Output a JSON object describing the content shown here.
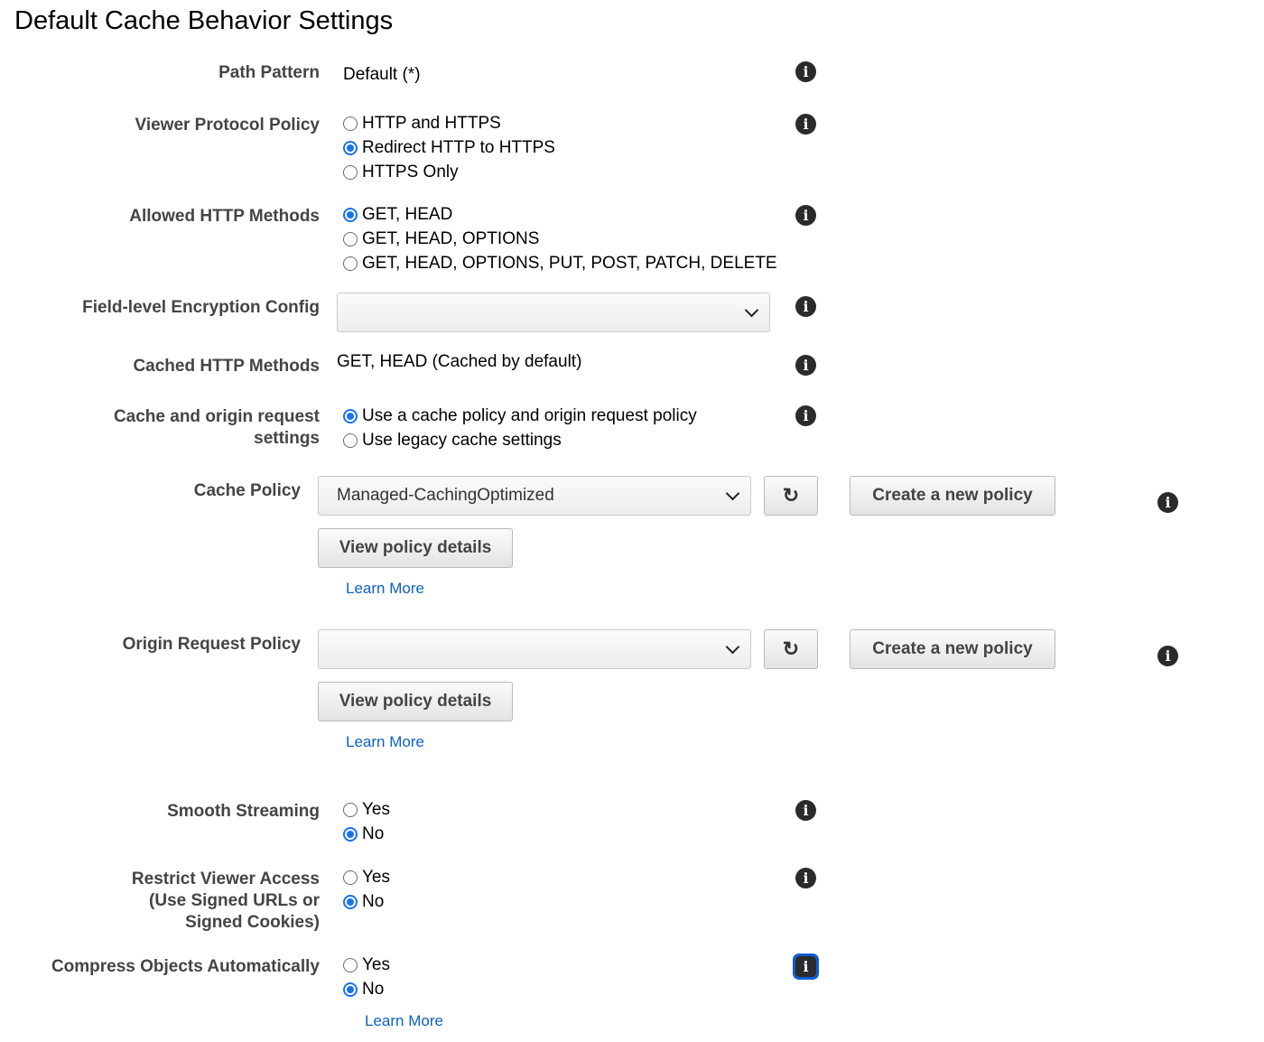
{
  "page_title": "Default Cache Behavior Settings",
  "path_pattern": {
    "label": "Path Pattern",
    "value": "Default (*)"
  },
  "viewer_protocol_policy": {
    "label": "Viewer Protocol Policy",
    "options": [
      "HTTP and HTTPS",
      "Redirect HTTP to HTTPS",
      "HTTPS Only"
    ],
    "selected": "Redirect HTTP to HTTPS"
  },
  "allowed_http_methods": {
    "label": "Allowed HTTP Methods",
    "options": [
      "GET, HEAD",
      "GET, HEAD, OPTIONS",
      "GET, HEAD, OPTIONS, PUT, POST, PATCH, DELETE"
    ],
    "selected": "GET, HEAD"
  },
  "field_level_encryption": {
    "label": "Field-level Encryption Config",
    "value": ""
  },
  "cached_http_methods": {
    "label": "Cached HTTP Methods",
    "value": "GET, HEAD (Cached by default)"
  },
  "cache_origin_settings": {
    "label_line1": "Cache and origin request",
    "label_line2": "settings",
    "options": [
      "Use a cache policy and origin request policy",
      "Use legacy cache settings"
    ],
    "selected": "Use a cache policy and origin request policy"
  },
  "cache_policy": {
    "label": "Cache Policy",
    "value": "Managed-CachingOptimized",
    "create_label": "Create a new policy",
    "view_label": "View policy details",
    "learn_more": "Learn More"
  },
  "origin_request_policy": {
    "label": "Origin Request Policy",
    "value": "",
    "create_label": "Create a new policy",
    "view_label": "View policy details",
    "learn_more": "Learn More"
  },
  "smooth_streaming": {
    "label": "Smooth Streaming",
    "options": [
      "Yes",
      "No"
    ],
    "selected": "No"
  },
  "restrict_viewer_access": {
    "label_line1": "Restrict Viewer Access",
    "label_line2": "(Use Signed URLs or",
    "label_line3": "Signed Cookies)",
    "options": [
      "Yes",
      "No"
    ],
    "selected": "No"
  },
  "compress_objects": {
    "label": "Compress Objects Automatically",
    "options": [
      "Yes",
      "No"
    ],
    "selected": "No",
    "learn_more": "Learn More"
  },
  "icons": {
    "info": "info-icon",
    "refresh": "refresh-icon",
    "dropdown": "chevron-down-icon"
  },
  "colors": {
    "accent": "#1a73e8",
    "link": "#0b61c4",
    "label": "#444444"
  }
}
